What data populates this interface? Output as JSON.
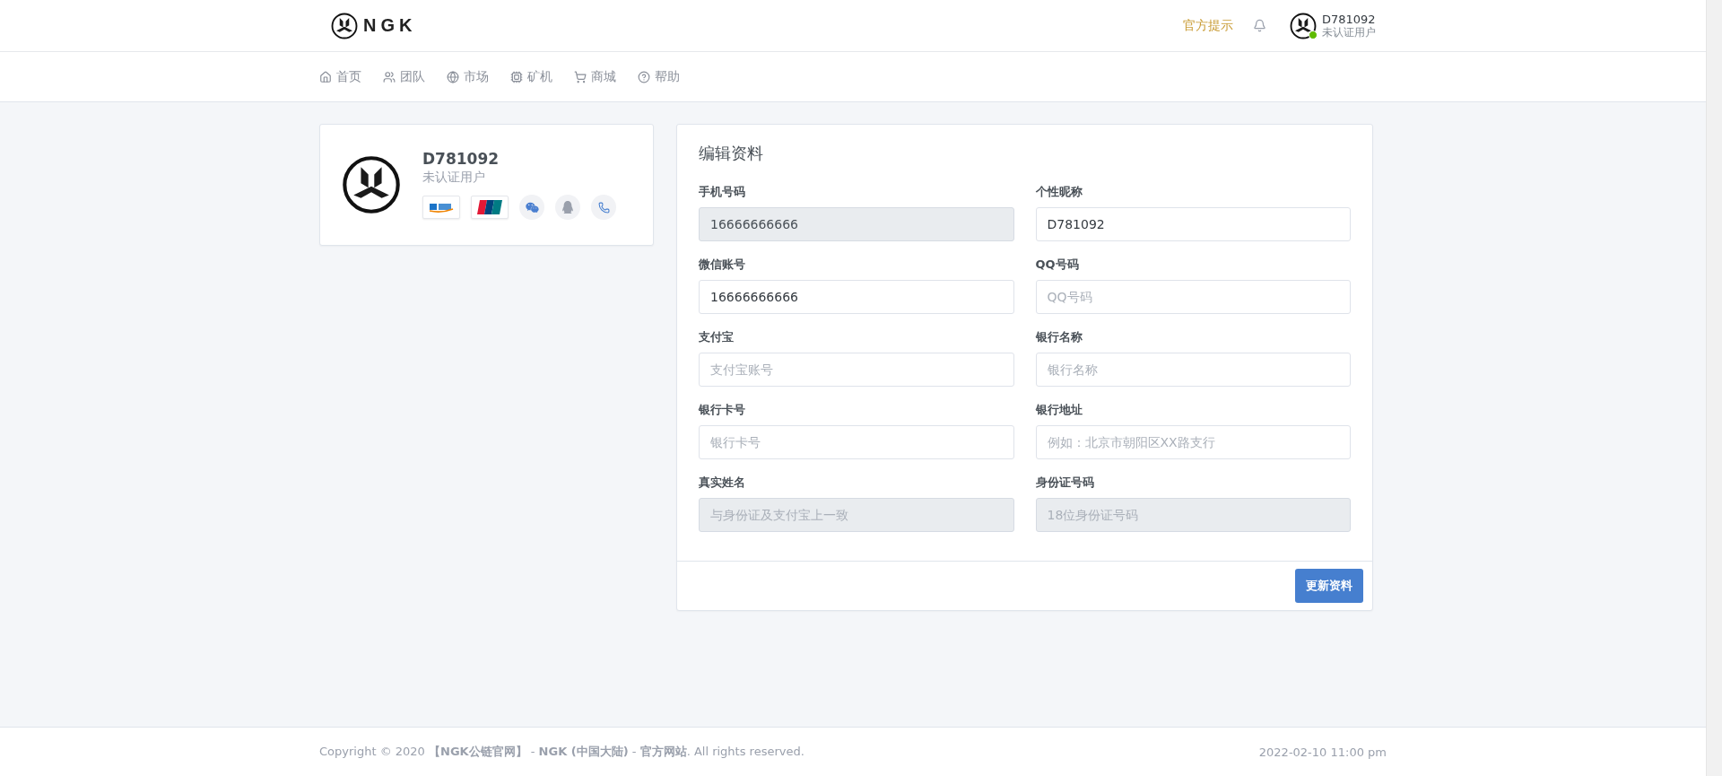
{
  "header": {
    "logo_text": "NGK",
    "notice_link": "官方提示",
    "user": {
      "name": "D781092",
      "status": "未认证用户",
      "online": true
    }
  },
  "nav": [
    {
      "label": "首页"
    },
    {
      "label": "团队"
    },
    {
      "label": "市场"
    },
    {
      "label": "矿机"
    },
    {
      "label": "商城"
    },
    {
      "label": "帮助"
    }
  ],
  "profile_card": {
    "name": "D781092",
    "status": "未认证用户"
  },
  "edit_form": {
    "title": "编辑资料",
    "fields": [
      {
        "label": "手机号码",
        "value": "16666666666",
        "disabled": true
      },
      {
        "label": "个性昵称",
        "value": "D781092",
        "disabled": false
      },
      {
        "label": "微信账号",
        "value": "16666666666",
        "disabled": false
      },
      {
        "label": "QQ号码",
        "placeholder": "QQ号码",
        "disabled": false
      },
      {
        "label": "支付宝",
        "placeholder": "支付宝账号",
        "disabled": false
      },
      {
        "label": "银行名称",
        "placeholder": "银行名称",
        "disabled": false
      },
      {
        "label": "银行卡号",
        "placeholder": "银行卡号",
        "disabled": false
      },
      {
        "label": "银行地址",
        "placeholder": "例如：北京市朝阳区XX路支行",
        "disabled": false
      },
      {
        "label": "真实姓名",
        "placeholder": "与身份证及支付宝上一致",
        "disabled": true
      },
      {
        "label": "身份证号码",
        "placeholder": "18位身份证号码",
        "disabled": true
      }
    ],
    "submit": "更新资料"
  },
  "footer": {
    "copyright": "Copyright © 2020 **【NGK公链官网】** - **NGK (中国大陆)** - **官方网站**. All rights reserved.",
    "datetime": "2022-02-10 11:00 pm"
  }
}
